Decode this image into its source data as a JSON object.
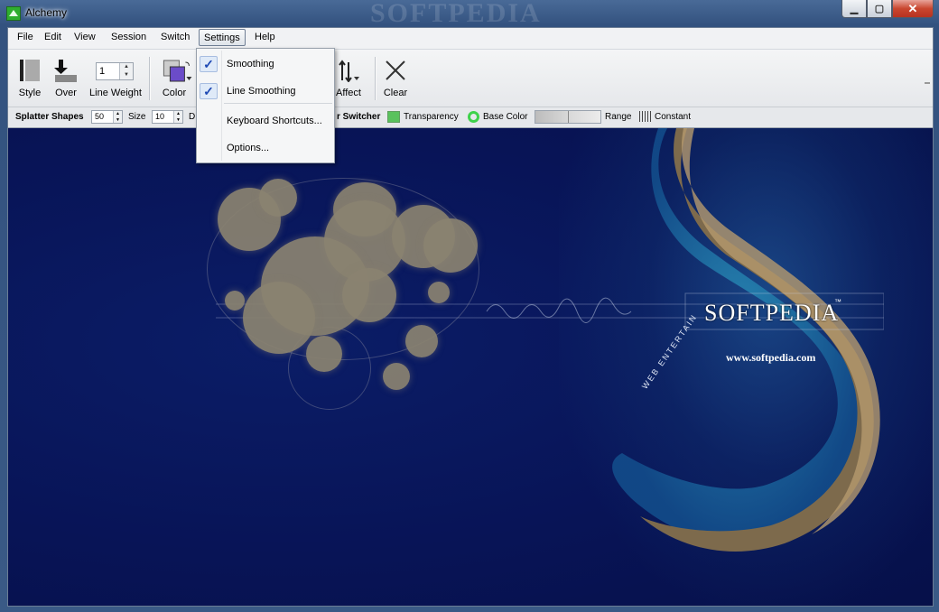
{
  "window": {
    "title": "Alchemy",
    "watermark": "SOFTPEDIA",
    "controls": {
      "minimize": "▁",
      "maximize": "▢",
      "close": "✕"
    }
  },
  "menubar": {
    "items": [
      "File",
      "Edit",
      "View",
      "Session",
      "Switch",
      "Settings",
      "Help"
    ],
    "active": "Settings"
  },
  "toolbar": {
    "style_label": "Style",
    "over_label": "Over",
    "line_weight_label": "Line Weight",
    "line_weight_value": "1",
    "color_label": "Color",
    "affect_label": "Affect",
    "clear_label": "Clear",
    "icons": {
      "style": "style-icon",
      "over": "over-icon",
      "color": "color-swatch-icon",
      "affect": "affect-icon",
      "clear": "close-x-icon"
    }
  },
  "propbar": {
    "splatter_label": "Splatter Shapes",
    "splatter_value": "50",
    "size_label": "Size",
    "size_value": "10",
    "partial_d": "D",
    "switcher_label": "r Switcher",
    "transparency_label": "Transparency",
    "base_color_label": "Base Color",
    "range_label": "Range",
    "constant_label": "Constant",
    "colors": {
      "transparency": "#59c25d",
      "base_color": "#3fd24b"
    }
  },
  "settings_menu": {
    "items": [
      {
        "label": "Smoothing",
        "checked": true
      },
      {
        "label": "Line Smoothing",
        "checked": true
      },
      {
        "label": "Keyboard Shortcuts...",
        "checked": false
      },
      {
        "label": "Options...",
        "checked": false
      }
    ]
  },
  "canvas": {
    "logo_text": "SOFTPEDIA",
    "trademark": "™",
    "url": "www.softpedia.com",
    "curved_text": "WEB ENTERTAIN"
  }
}
